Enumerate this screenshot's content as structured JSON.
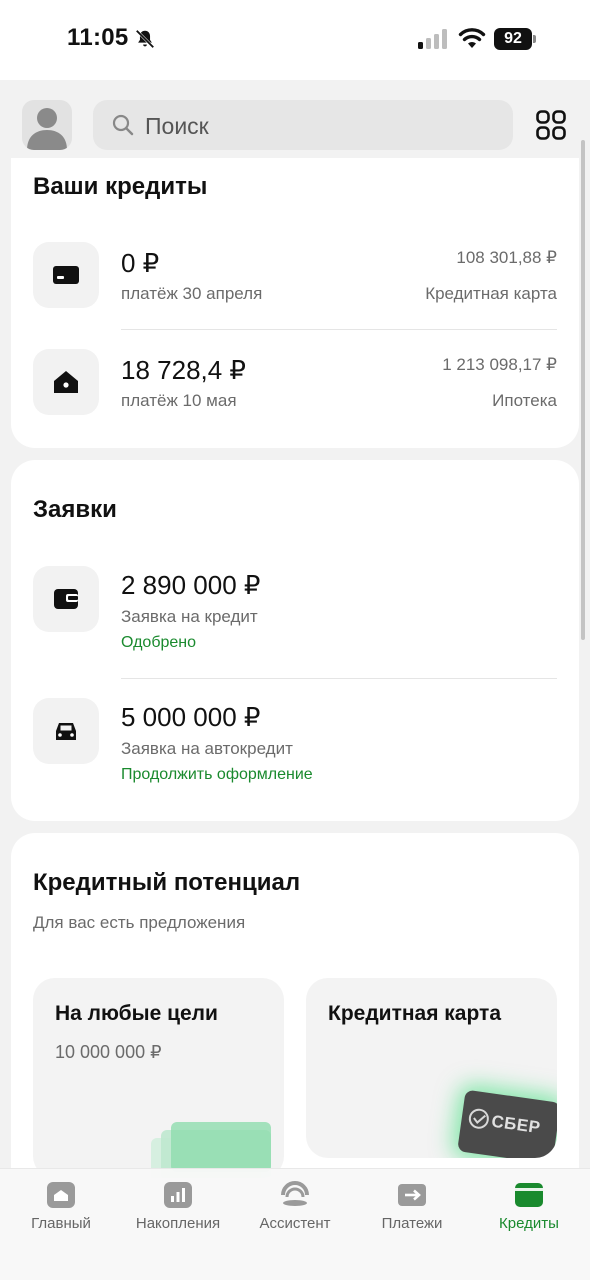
{
  "status_bar": {
    "time": "11:05",
    "battery": "92"
  },
  "search": {
    "placeholder": "Поиск"
  },
  "credits": {
    "title": "Ваши кредиты",
    "items": [
      {
        "amount": "0 ₽",
        "payment": "платёж 30 апреля",
        "total": "108 301,88 ₽",
        "type": "Кредитная карта",
        "icon": "card-icon"
      },
      {
        "amount": "18 728,4 ₽",
        "payment": "платёж 10 мая",
        "total": "1 213 098,17 ₽",
        "type": "Ипотека",
        "icon": "house-icon"
      }
    ]
  },
  "applications": {
    "title": "Заявки",
    "items": [
      {
        "amount": "2 890 000 ₽",
        "label": "Заявка на кредит",
        "status": "Одобрено",
        "icon": "wallet-icon"
      },
      {
        "amount": "5 000 000 ₽",
        "label": "Заявка на автокредит",
        "status": "Продолжить оформление",
        "icon": "car-icon"
      }
    ]
  },
  "potential": {
    "title": "Кредитный потенциал",
    "subtitle": "Для вас есть предложения",
    "offers": [
      {
        "title": "На любые цели",
        "amount": "10 000 000 ₽"
      },
      {
        "title": "Кредитная карта",
        "card_brand": "СБЕР"
      }
    ]
  },
  "tabs": [
    {
      "label": "Главный",
      "icon": "home-icon",
      "active": false
    },
    {
      "label": "Накопления",
      "icon": "savings-chart-icon",
      "active": false
    },
    {
      "label": "Ассистент",
      "icon": "assistant-icon",
      "active": false
    },
    {
      "label": "Платежи",
      "icon": "payments-arrow-icon",
      "active": false
    },
    {
      "label": "Кредиты",
      "icon": "credits-wallet-icon",
      "active": true
    }
  ],
  "colors": {
    "accent_green": "#1a8a2e",
    "background": "#f2f2f2",
    "card": "#ffffff"
  }
}
